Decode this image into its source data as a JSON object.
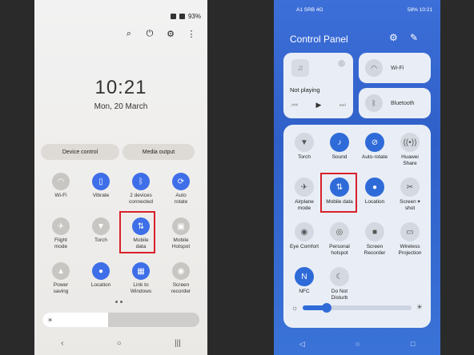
{
  "left": {
    "status": {
      "battery": "93%"
    },
    "clock": "10:21",
    "date": "Mon, 20 March",
    "pills": [
      "Device control",
      "Media output"
    ],
    "tiles": [
      {
        "label": "Wi-Fi",
        "icon": "wifi-icon",
        "glyph": "◠",
        "on": false
      },
      {
        "label": "Vibrate",
        "icon": "vibrate-icon",
        "glyph": "▯",
        "on": true
      },
      {
        "label": "2 devices\nconnected",
        "icon": "bluetooth-icon",
        "glyph": "ᛒ",
        "on": true
      },
      {
        "label": "Auto\nrotate",
        "icon": "auto-rotate-icon",
        "glyph": "⟳",
        "on": true
      },
      {
        "label": "Flight\nmode",
        "icon": "airplane-icon",
        "glyph": "✈",
        "on": false
      },
      {
        "label": "Torch",
        "icon": "torch-icon",
        "glyph": "▼",
        "on": false
      },
      {
        "label": "Mobile\ndata",
        "icon": "mobile-data-icon",
        "glyph": "⇅",
        "on": true
      },
      {
        "label": "Mobile\nHotspot",
        "icon": "hotspot-icon",
        "glyph": "▣",
        "on": false
      },
      {
        "label": "Power\nsaving",
        "icon": "power-saving-icon",
        "glyph": "▲",
        "on": false
      },
      {
        "label": "Location",
        "icon": "location-icon",
        "glyph": "●",
        "on": true
      },
      {
        "label": "Link to\nWindows",
        "icon": "link-windows-icon",
        "glyph": "▦",
        "on": true
      },
      {
        "label": "Screen\nrecorder",
        "icon": "screen-recorder-icon",
        "glyph": "◉",
        "on": false
      }
    ],
    "brightness": 0.42,
    "nav": [
      "‹",
      "○",
      "|||"
    ]
  },
  "right": {
    "status": {
      "left": "A1 SRB 4G",
      "battery": "58%",
      "time": "10:21"
    },
    "title": "Control Panel",
    "media": {
      "label": "Not playing"
    },
    "wifi_label": "Wi-Fi",
    "bluetooth_label": "Bluetooth",
    "tiles": [
      {
        "label": "Torch",
        "icon": "torch-icon",
        "glyph": "▼",
        "on": false
      },
      {
        "label": "Sound",
        "icon": "bell-icon",
        "glyph": "♪",
        "on": true
      },
      {
        "label": "Auto-rotate",
        "icon": "auto-rotate-icon",
        "glyph": "⊘",
        "on": true
      },
      {
        "label": "Huawei\nShare",
        "icon": "huawei-share-icon",
        "glyph": "((•))",
        "on": false
      },
      {
        "label": "Airplane\nmode",
        "icon": "airplane-icon",
        "glyph": "✈",
        "on": false
      },
      {
        "label": "Mobile data",
        "icon": "mobile-data-icon",
        "glyph": "⇅",
        "on": true
      },
      {
        "label": "Location",
        "icon": "location-icon",
        "glyph": "●",
        "on": true
      },
      {
        "label": "Screen ▾\nshot",
        "icon": "screenshot-icon",
        "glyph": "✂",
        "on": false
      },
      {
        "label": "Eye Comfort",
        "icon": "eye-comfort-icon",
        "glyph": "◉",
        "on": false
      },
      {
        "label": "Personal\nhotspot",
        "icon": "hotspot-icon",
        "glyph": "◎",
        "on": false
      },
      {
        "label": "Screen\nRecorder",
        "icon": "screen-recorder-icon",
        "glyph": "■",
        "on": false
      },
      {
        "label": "Wireless\nProjection",
        "icon": "projection-icon",
        "glyph": "▭",
        "on": false
      },
      {
        "label": "NFC",
        "icon": "nfc-icon",
        "glyph": "N",
        "on": true
      },
      {
        "label": "Do Not\nDisturb",
        "icon": "moon-icon",
        "glyph": "☾",
        "on": false
      }
    ],
    "brightness": 0.22,
    "nav": [
      "◁",
      "○",
      "□"
    ]
  }
}
